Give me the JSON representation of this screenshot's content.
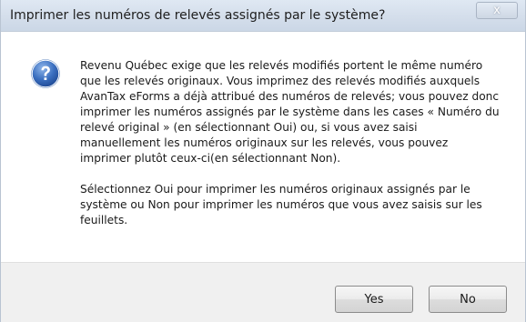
{
  "window": {
    "title": "Imprimer les numéros de relevés assignés par le système?",
    "close_label": "x"
  },
  "icon": "question-icon",
  "message": {
    "paragraph1": "Revenu Québec exige que les relevés modifiés portent le même numéro que les relevés originaux. Vous imprimez des relevés modifiés auxquels AvanTax eForms a déjà attribué des numéros de relevés; vous pouvez donc imprimer les numéros assignés par le système dans les cases « Numéro du relevé original » (en sélectionnant Oui) ou, si vous avez saisi manuellement les numéros originaux sur les relevés, vous pouvez imprimer plutôt ceux-ci(en sélectionnant Non).",
    "paragraph2": "Sélectionnez Oui pour imprimer les numéros originaux assignés par le système ou Non pour imprimer les numéros que vous avez saisis sur les feuillets."
  },
  "buttons": {
    "yes": "Yes",
    "no": "No"
  },
  "colors": {
    "icon_blue": "#2a5fb0",
    "titlebar": "#d4deeb",
    "footer": "#f0f0f0"
  }
}
